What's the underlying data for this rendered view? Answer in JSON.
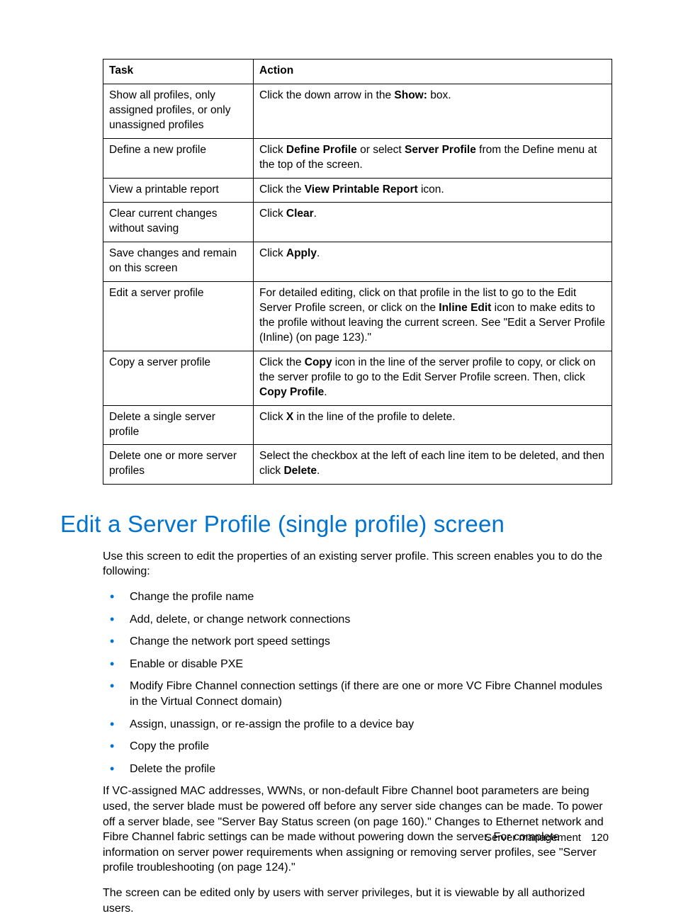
{
  "table": {
    "headers": {
      "task": "Task",
      "action": "Action"
    },
    "rows": [
      {
        "task": "Show all profiles, only assigned profiles, or only unassigned profiles",
        "action_parts": [
          "Click the down arrow in the ",
          "Show:",
          " box."
        ]
      },
      {
        "task": "Define a new profile",
        "action_parts": [
          "Click ",
          "Define Profile",
          " or select ",
          "Server Profile",
          " from the Define menu at the top of the screen."
        ]
      },
      {
        "task": "View a printable report",
        "action_parts": [
          "Click the ",
          "View Printable Report",
          " icon."
        ]
      },
      {
        "task": "Clear current changes without saving",
        "action_parts": [
          "Click ",
          "Clear",
          "."
        ]
      },
      {
        "task": "Save changes and remain on this screen",
        "action_parts": [
          "Click ",
          "Apply",
          "."
        ]
      },
      {
        "task": "Edit a server profile",
        "action_parts": [
          "For detailed editing, click on that profile in the list to go to the Edit Server Profile screen, or click on the ",
          "Inline Edit",
          " icon to make edits to the profile without leaving the current screen. See \"Edit a Server Profile (Inline) (on page 123).\""
        ]
      },
      {
        "task": "Copy a server profile",
        "action_parts": [
          "Click the ",
          "Copy",
          " icon in the line of the server profile to copy, or click on the server profile to go to the Edit Server Profile screen. Then, click ",
          "Copy Profile",
          "."
        ]
      },
      {
        "task": "Delete a single server profile",
        "action_parts": [
          "Click ",
          "X",
          " in the line of the profile to delete."
        ]
      },
      {
        "task": "Delete one or more server profiles",
        "action_parts": [
          "Select the checkbox at the left of each line item to be deleted, and then click ",
          "Delete",
          "."
        ]
      }
    ]
  },
  "heading": "Edit a Server Profile (single profile) screen",
  "intro": "Use this screen to edit the properties of an existing server profile. This screen enables you to do the following:",
  "bullets": [
    "Change the profile name",
    "Add, delete, or change network connections",
    "Change the network port speed settings",
    "Enable or disable PXE",
    "Modify Fibre Channel connection settings (if there are one or more VC Fibre Channel modules in the Virtual Connect domain)",
    "Assign, unassign, or re-assign the profile to a device bay",
    "Copy the profile",
    "Delete the profile"
  ],
  "para2": "If VC-assigned MAC addresses, WWNs, or non-default Fibre Channel boot parameters are being used, the server blade must be powered off before any server side changes can be made. To power off a server blade, see \"Server Bay Status screen (on page 160).\" Changes to Ethernet network and Fibre Channel fabric settings can be made without powering down the server. For complete information on server power requirements when assigning or removing server profiles, see \"Server profile troubleshooting (on page 124).\"",
  "para3": "The screen can be edited only by users with server privileges, but it is viewable by all authorized users.",
  "footer": {
    "section": "Server management",
    "page": "120"
  }
}
